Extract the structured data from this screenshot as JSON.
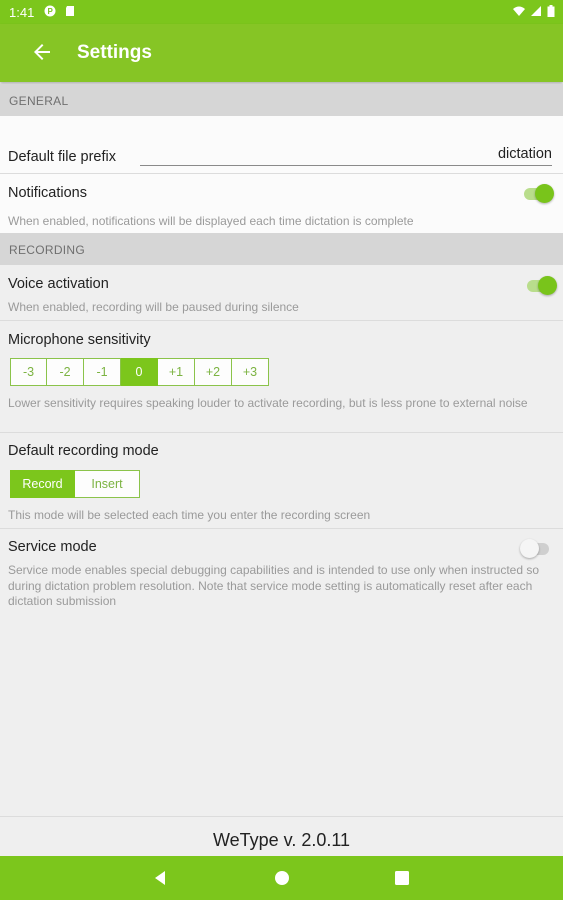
{
  "status_bar": {
    "time": "1:41"
  },
  "app_bar": {
    "title": "Settings"
  },
  "sections": {
    "general": "GENERAL",
    "recording": "RECORDING"
  },
  "general": {
    "file_prefix_label": "Default file prefix",
    "file_prefix_value": "dictation",
    "notifications_label": "Notifications",
    "notifications_desc": "When enabled, notifications will be displayed each time dictation is complete",
    "notifications_on": true
  },
  "recording": {
    "voice_activation_label": "Voice activation",
    "voice_activation_desc": "When enabled, recording will be paused during silence",
    "voice_activation_on": true,
    "mic_label": "Microphone sensitivity",
    "mic_options": [
      "-3",
      "-2",
      "-1",
      "0",
      "+1",
      "+2",
      "+3"
    ],
    "mic_selected": "0",
    "mic_desc": "Lower sensitivity requires speaking louder to activate recording, but is less prone to external noise",
    "mode_label": "Default recording mode",
    "mode_options": [
      "Record",
      "Insert"
    ],
    "mode_selected": "Record",
    "mode_desc": "This mode will be selected each time you enter the recording screen",
    "service_label": "Service mode",
    "service_desc": "Service mode enables special debugging capabilities and is intended to use only when instructed so during dictation problem resolution. Note that service mode setting is automatically reset after each dictation submission",
    "service_on": false
  },
  "footer": {
    "version": "WeType v. 2.0.11"
  },
  "colors": {
    "accent": "#7cc61c",
    "accent_light": "#b9dd8c",
    "section_bg": "#d6d6d6"
  }
}
